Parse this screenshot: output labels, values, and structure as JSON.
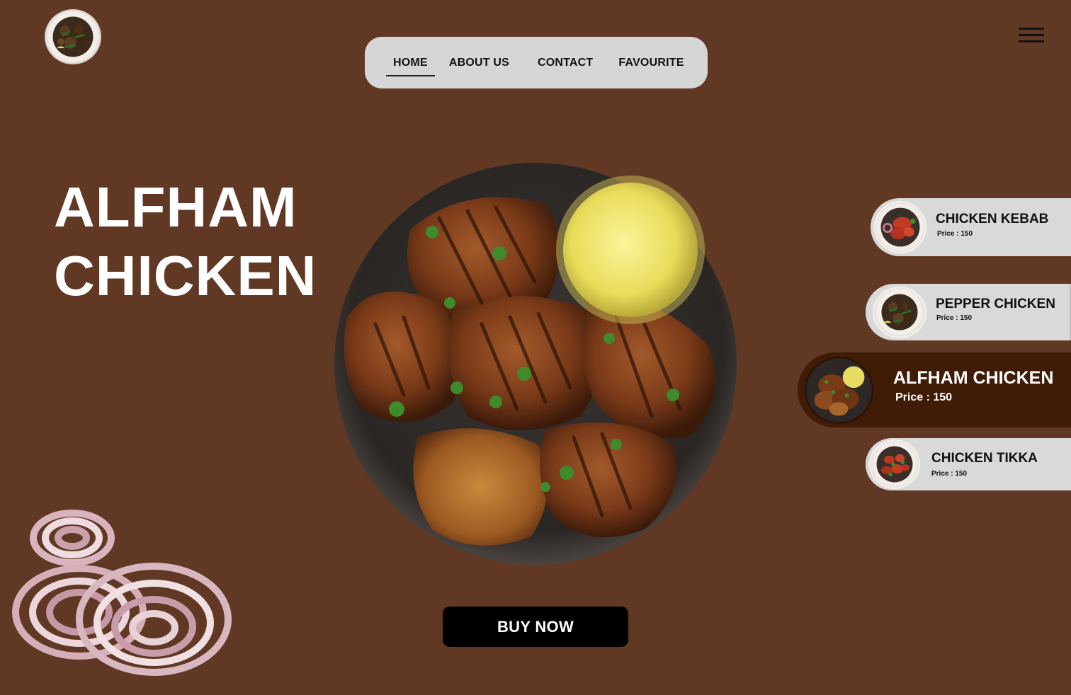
{
  "colors": {
    "background": "#603823",
    "nav_background": "#d6d6d6",
    "card_background": "#d9d9d9",
    "active_card_background": "#401b06",
    "button_background": "#000000"
  },
  "logo": {
    "icon": "pepper-chicken-plate-logo"
  },
  "nav": {
    "items": [
      {
        "label": "HOME",
        "active": true
      },
      {
        "label": "ABOUT US",
        "active": false
      },
      {
        "label": "CONTACT",
        "active": false
      },
      {
        "label": "FAVOURITE",
        "active": false
      }
    ]
  },
  "menu_icon": "hamburger-menu-icon",
  "hero": {
    "title_line1": "ALFHAM",
    "title_line2": "CHICKEN",
    "image": "grilled-chicken-plate"
  },
  "buy_button": {
    "label": "BUY NOW"
  },
  "menu_cards": [
    {
      "name": "CHICKEN KEBAB",
      "price": "Price : 150",
      "image": "chicken-kebab-plate"
    },
    {
      "name": "PEPPER CHICKEN",
      "price": "Price : 150",
      "image": "pepper-chicken-plate"
    },
    {
      "name": "ALFHAM CHICKEN",
      "price": "Price : 150",
      "image": "alfham-chicken-plate",
      "active": true
    },
    {
      "name": "CHICKEN TIKKA",
      "price": "Price : 150",
      "image": "chicken-tikka-plate"
    }
  ],
  "decoration": "onion-rings-image"
}
